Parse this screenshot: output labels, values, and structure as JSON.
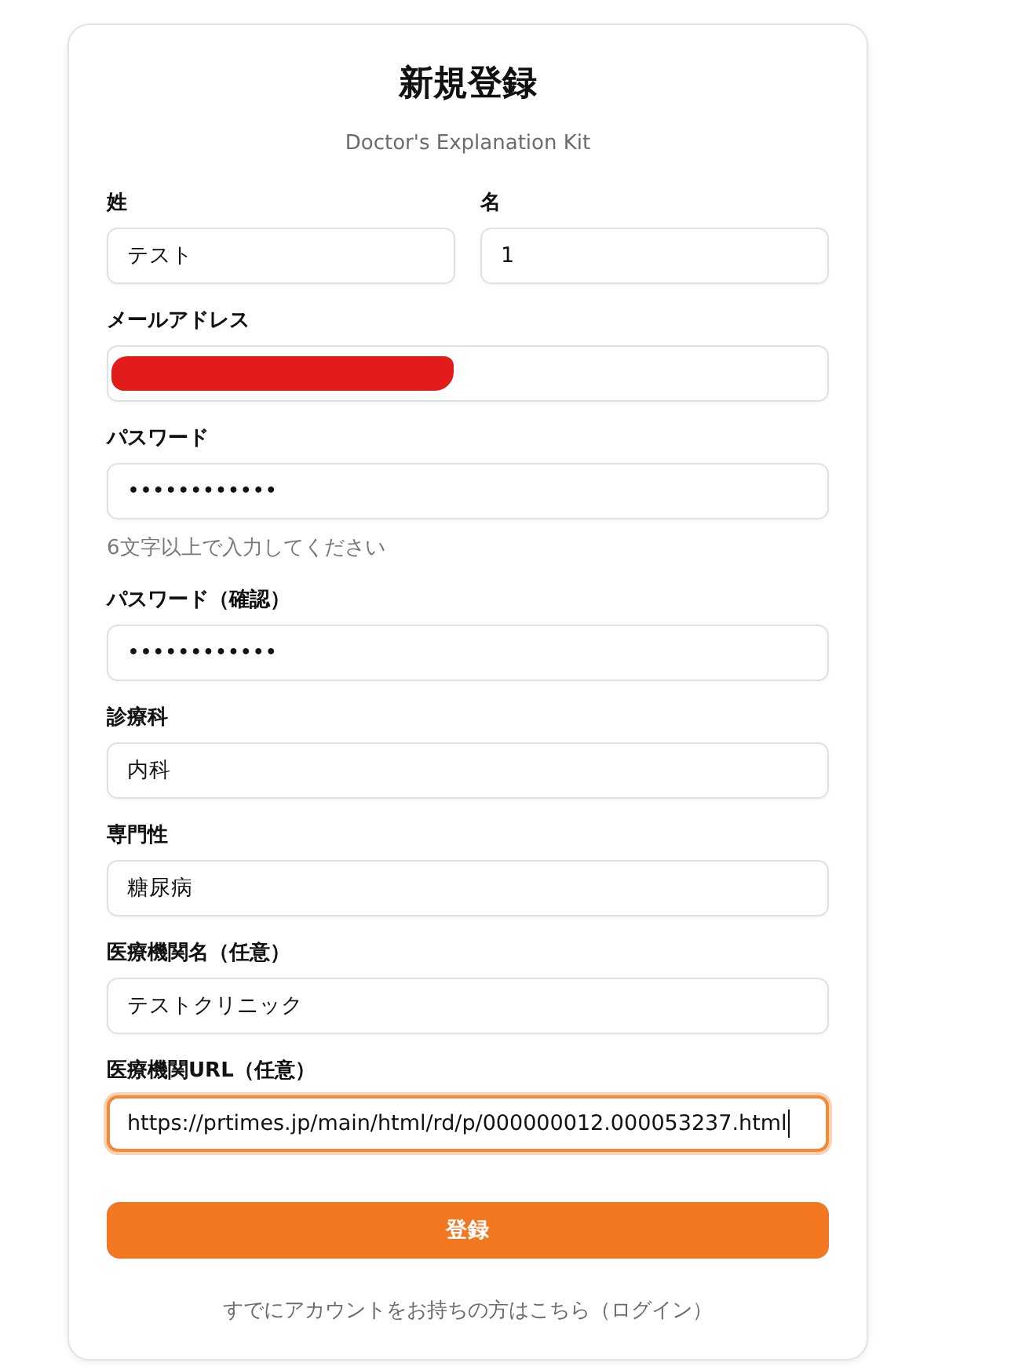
{
  "title": "新規登録",
  "subtitle": "Doctor's Explanation Kit",
  "name_row": [
    {
      "label": "姓",
      "value": "テスト"
    },
    {
      "label": "名",
      "value": "1"
    }
  ],
  "fields": [
    {
      "label": "メールアドレス",
      "redacted": true,
      "focused": false
    },
    {
      "label": "パスワード",
      "value": "••••••••••••",
      "hint": "6文字以上で入力してください",
      "focused": false
    },
    {
      "label": "パスワード（確認）",
      "value": "••••••••••••",
      "focused": false
    },
    {
      "label": "診療科",
      "value": "内科",
      "focused": false
    },
    {
      "label": "専門性",
      "value": "糖尿病",
      "focused": false
    },
    {
      "label": "医療機関名（任意）",
      "value": "テストクリニック",
      "focused": false
    },
    {
      "label": "医療機関URL（任意）",
      "value": "https://prtimes.jp/main/html/rd/p/000000012.000053237.html",
      "focused": true
    }
  ],
  "submit": "登録",
  "login_link": "すでにアカウントをお持ちの方はこちら（ログイン）"
}
